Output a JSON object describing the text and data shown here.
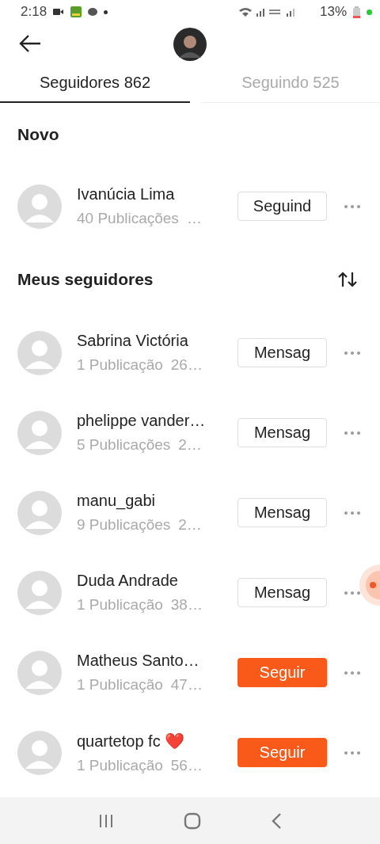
{
  "status_bar": {
    "time": "2:18",
    "battery": "13%"
  },
  "tabs": [
    {
      "label": "Seguidores 862",
      "selected": true
    },
    {
      "label": "Seguindo 525",
      "selected": false
    }
  ],
  "sections": [
    {
      "title": "Novo",
      "users": [
        {
          "name": "Ivanúcia Lima",
          "posts": "40 Publicações",
          "extra": "…",
          "button": "Seguind",
          "kind": "outlined"
        }
      ]
    },
    {
      "title": "Meus seguidores",
      "sortable": true,
      "users": [
        {
          "name": "Sabrina Victória",
          "posts": "1 Publicação",
          "extra": "26…",
          "button": "Mensag",
          "kind": "outlined"
        },
        {
          "name": "phelippe vander…",
          "posts": "5 Publicações",
          "extra": "2…",
          "button": "Mensag",
          "kind": "outlined"
        },
        {
          "name": "manu_gabi",
          "posts": "9 Publicações",
          "extra": "2…",
          "button": "Mensag",
          "kind": "outlined"
        },
        {
          "name": "Duda Andrade",
          "posts": "1 Publicação",
          "extra": "38…",
          "button": "Mensag",
          "kind": "outlined"
        },
        {
          "name": "Matheus Santo…",
          "posts": "1 Publicação",
          "extra": "47…",
          "button": "Seguir",
          "kind": "filled"
        },
        {
          "name": "quartetop fc ❤️",
          "posts": "1 Publicação",
          "extra": "56…",
          "button": "Seguir",
          "kind": "filled"
        }
      ]
    }
  ]
}
